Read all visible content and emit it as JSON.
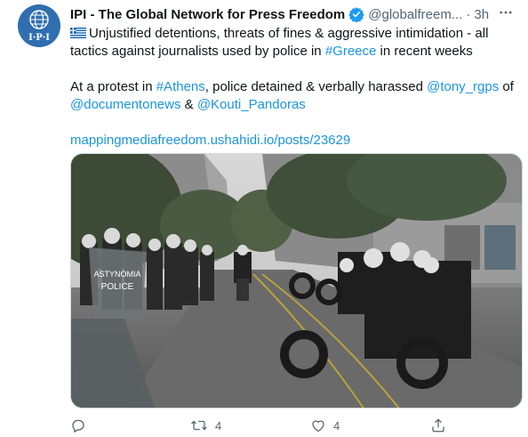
{
  "tweet": {
    "display_name": "IPI - The Global Network for Press Freedom",
    "handle": "@globalfreem...",
    "separator": "·",
    "time": "3h",
    "line1_text": "Unjustified detentions, threats of fines & aggressive intimidation - all tactics against journalists used by police in ",
    "hashtag_greece": "#Greece",
    "line1_tail": " in recent weeks",
    "p2_start": "At a protest in ",
    "hashtag_athens": "#Athens",
    "p2_mid": ", police detained & verbally harassed ",
    "mention_tony": "@tony_rgps",
    "p2_of": " of",
    "mention_documento": "@documentonews",
    "p2_and": " & ",
    "mention_kouti": "@Kouti_Pandoras",
    "link_url": "mappingmediafreedom.ushahidi.io/posts/23629",
    "media_image_text": {
      "shield_text_1": "ASTYNOMIA",
      "shield_text_2": "POLICE"
    }
  },
  "actions": {
    "reply_count": "",
    "retweet_count": "4",
    "like_count": "4"
  },
  "colors": {
    "link": "#1b95e0",
    "verified": "#1d9bf0",
    "avatar_bg": "#2f6fb0"
  },
  "icons": [
    "ipi-logo-icon",
    "verified-badge-icon",
    "more-options-icon",
    "greece-flag-icon",
    "reply-icon",
    "retweet-icon",
    "like-icon",
    "share-icon"
  ]
}
